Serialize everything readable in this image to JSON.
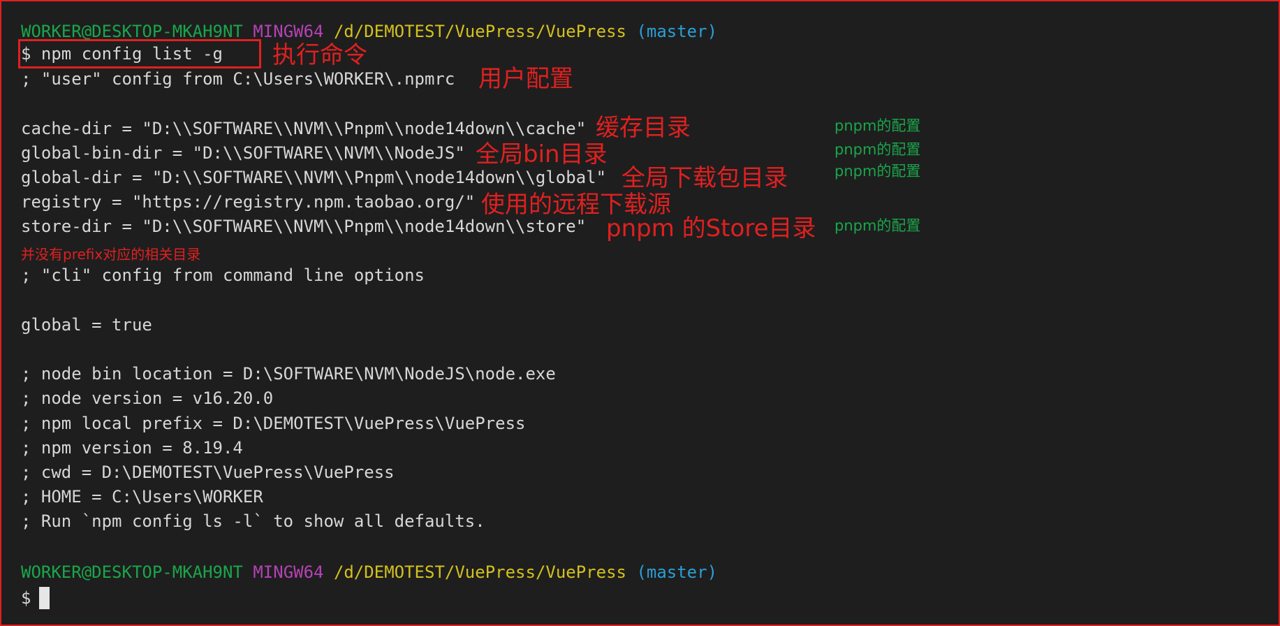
{
  "prompt": {
    "user_host": "WORKER@DESKTOP-MKAH9NT",
    "shell": "MINGW64",
    "path": "/d/DEMOTEST/VuePress/VuePress",
    "branch": "(master)",
    "symbol": "$"
  },
  "command": "npm config list -g",
  "output": {
    "user_config_header": "; \"user\" config from C:\\Users\\WORKER\\.npmrc",
    "cache_dir": "cache-dir = \"D:\\\\SOFTWARE\\\\NVM\\\\Pnpm\\\\node14down\\\\cache\"",
    "global_bin_dir": "global-bin-dir = \"D:\\\\SOFTWARE\\\\NVM\\\\NodeJS\"",
    "global_dir": "global-dir = \"D:\\\\SOFTWARE\\\\NVM\\\\Pnpm\\\\node14down\\\\global\"",
    "registry": "registry = \"https://registry.npm.taobao.org/\"",
    "store_dir": "store-dir = \"D:\\\\SOFTWARE\\\\NVM\\\\Pnpm\\\\node14down\\\\store\"",
    "cli_config_header": "; \"cli\" config from command line options",
    "global": "global = true",
    "node_bin_location": "; node bin location = D:\\SOFTWARE\\NVM\\NodeJS\\node.exe",
    "node_version": "; node version = v16.20.0",
    "npm_local_prefix": "; npm local prefix = D:\\DEMOTEST\\VuePress\\VuePress",
    "npm_version": "; npm version = 8.19.4",
    "cwd": "; cwd = D:\\DEMOTEST\\VuePress\\VuePress",
    "home": "; HOME = C:\\Users\\WORKER",
    "run_hint": "; Run `npm config ls -l` to show all defaults."
  },
  "annotations": {
    "execute_command": "执行命令",
    "user_config": "用户配置",
    "cache_dir": "缓存目录",
    "global_bin": "全局bin目录",
    "global_download": "全局下载包目录",
    "registry_source": "使用的远程下载源",
    "pnpm_store": "pnpm 的Store目录",
    "no_prefix": "并没有prefix对应的相关目录",
    "pnpm_note_1": "pnpm的配置",
    "pnpm_note_2": "pnpm的配置",
    "pnpm_note_3": "pnpm的配置",
    "pnpm_note_4": "pnpm的配置"
  },
  "colors": {
    "background": "#1e1e1e",
    "annotation_red": "#e02020",
    "prompt_green": "#1aa64a",
    "prompt_purple": "#b542b5",
    "prompt_yellow": "#d4c11e",
    "prompt_cyan": "#2a9fd6"
  }
}
